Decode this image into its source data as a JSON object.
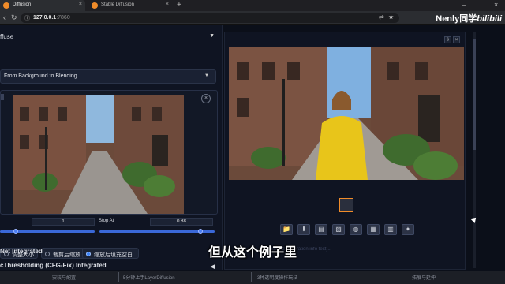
{
  "browser": {
    "tabs": [
      {
        "label": "Diffusion",
        "active": true
      },
      {
        "label": "Stable Diffusion",
        "active": false
      }
    ],
    "url_host": "127.0.0.1",
    "url_port": ":7860"
  },
  "watermark": {
    "author": "Nenly同学",
    "site": "bilibili"
  },
  "left": {
    "section_title": "ffuse",
    "accordion_label": "From Background to Blending",
    "start_value": "1",
    "stop_label": "Stop At",
    "stop_value": "0.88",
    "start_slider_fraction": 0.17,
    "stop_slider_fraction": 0.88,
    "radio_options": [
      {
        "label": "调整大小",
        "selected": false
      },
      {
        "label": "裁剪后缩放",
        "selected": false
      },
      {
        "label": "缩放后填充空白",
        "selected": true
      }
    ],
    "extensions": [
      {
        "label": "Net Integrated"
      },
      {
        "label": "cThresholding (CFG-Fix) Integrated"
      }
    ]
  },
  "right": {
    "toolbar_icons": [
      "folder-icon",
      "save-icon",
      "zip-icon",
      "image-icon",
      "palette-icon",
      "extras-icon",
      "layout-icon",
      "sparkle-icon"
    ],
    "info_text": "...(blurred generation info text)..."
  },
  "caption": "但从这个例子里",
  "chapters": [
    {
      "label": "安装与配置"
    },
    {
      "label": "5分钟上手LayerDiffusion"
    },
    {
      "label": "3种透明度操作玩法"
    },
    {
      "label": "拓展与延伸"
    }
  ],
  "colors": {
    "accent": "#3b82f6",
    "highlight": "#f08c2a",
    "bg": "#0b0f19"
  }
}
